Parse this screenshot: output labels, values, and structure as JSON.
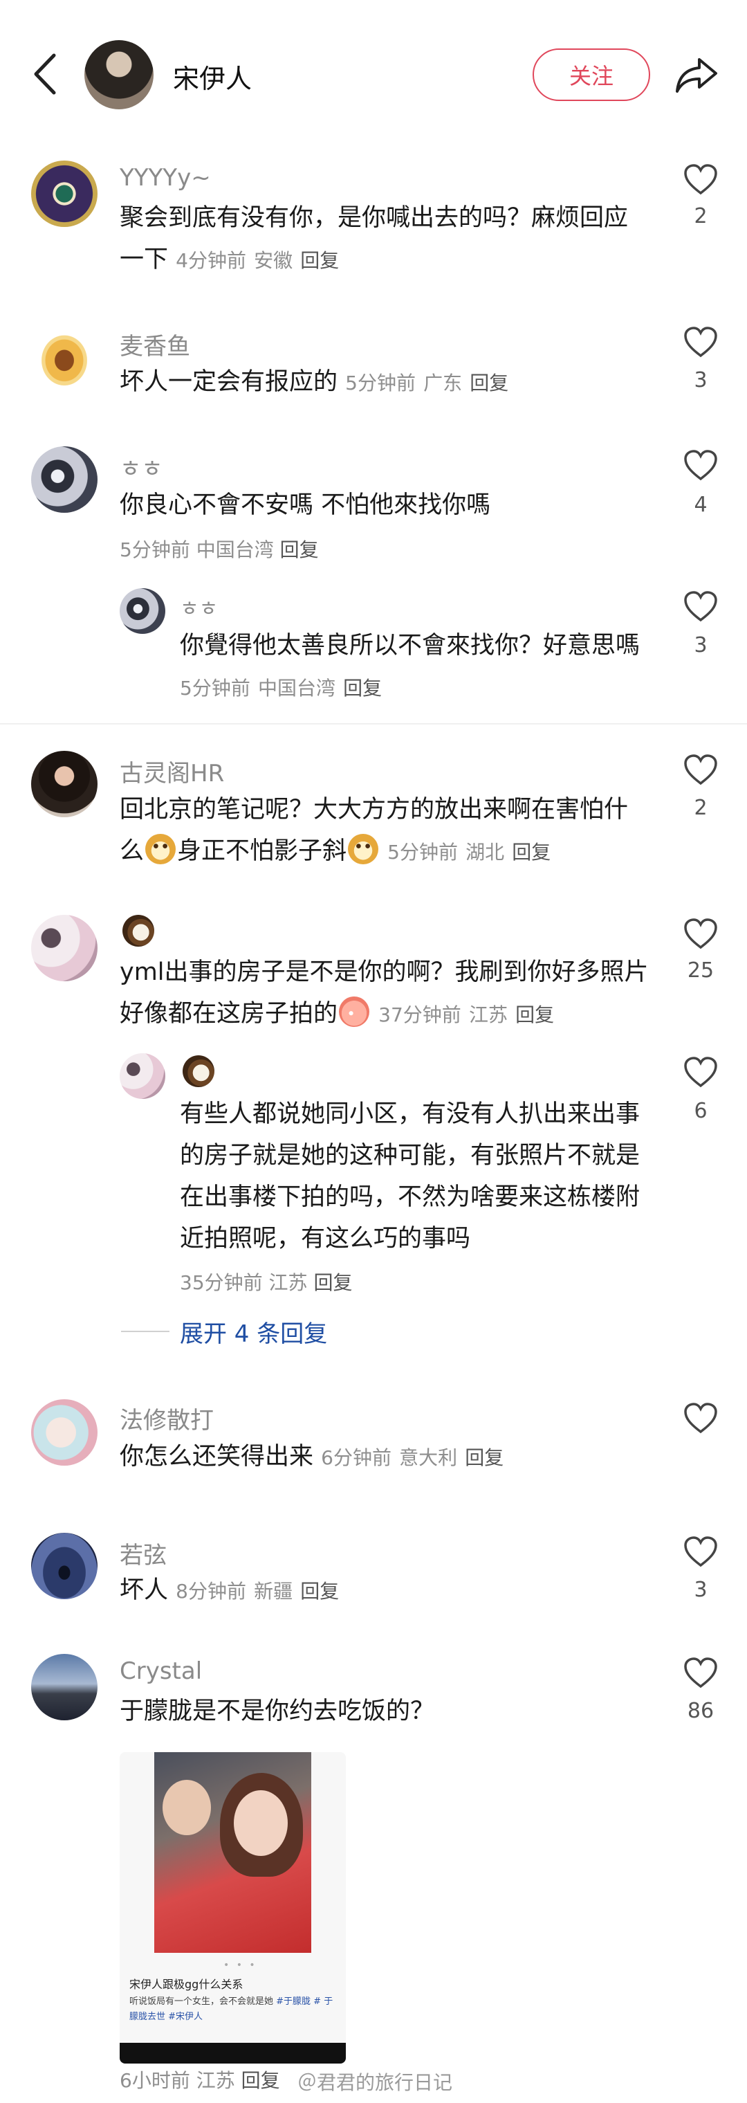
{
  "header": {
    "name": "宋伊人",
    "follow_label": "关注"
  },
  "comments": [
    {
      "user": "YYYYy~",
      "text": "聚会到底有没有你，是你喊出去的吗？麻烦回应一下",
      "time": "4分钟前",
      "location": "安徽",
      "reply": "回复",
      "likes": "2"
    },
    {
      "user": "麦香鱼",
      "text": "坏人一定会有报应的",
      "time": "5分钟前",
      "location": "广东",
      "reply": "回复",
      "likes": "3"
    },
    {
      "user": "ㅎㅎ",
      "text": "你良心不會不安嗎 不怕他來找你嗎",
      "time": "5分钟前",
      "location": "中国台湾",
      "reply": "回复",
      "likes": "4"
    },
    {
      "user": "ㅎㅎ",
      "text": "你覺得他太善良所以不會來找你？好意思嗎",
      "time": "5分钟前",
      "location": "中国台湾",
      "reply": "回复",
      "likes": "3"
    },
    {
      "user": "古灵阁HR",
      "text_a": "回北京的笔记呢？大大方方的放出来啊在害怕什么",
      "text_b": "身正不怕影子斜",
      "time": "5分钟前",
      "location": "湖北",
      "reply": "回复",
      "likes": "2"
    },
    {
      "user": "",
      "text": "yml出事的房子是不是你的啊？我刷到你好多照片好像都在这房子拍的",
      "time": "37分钟前",
      "location": "江苏",
      "reply": "回复",
      "likes": "25"
    },
    {
      "user": "",
      "text": "有些人都说她同小区，有没有人扒出来出事的房子就是她的这种可能，有张照片不就是在出事楼下拍的吗，不然为啥要来这栋楼附近拍照呢，有这么巧的事吗",
      "time": "35分钟前",
      "location": "江苏",
      "reply": "回复",
      "likes": "6"
    },
    {
      "user": "法修散打",
      "text": "你怎么还笑得出来",
      "time": "6分钟前",
      "location": "意大利",
      "reply": "回复",
      "likes": ""
    },
    {
      "user": "若弦",
      "text": "坏人",
      "time": "8分钟前",
      "location": "新疆",
      "reply": "回复",
      "likes": "3"
    },
    {
      "user": "Crystal",
      "text": "于朦胧是不是你约去吃饭的？",
      "time": "6小时前",
      "location": "江苏",
      "reply": "回复",
      "likes": "86"
    }
  ],
  "expand_label": "展开 4 条回复",
  "card": {
    "title": "宋伊人跟极gg什么关系",
    "desc": "听说饭局有一个女生，会不会就是她",
    "tags": "#于朦胧 # 于朦胧去世 #宋伊人"
  },
  "watermark": "＠君君的旅行日记"
}
